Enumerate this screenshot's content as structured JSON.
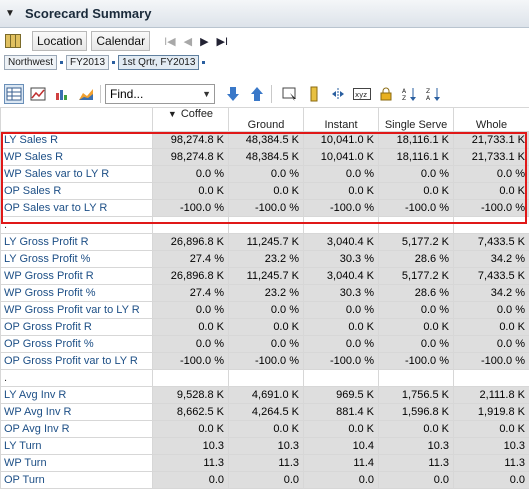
{
  "window": {
    "title": "Scorecard Summary"
  },
  "nav": {
    "location_label": "Location",
    "calendar_label": "Calendar",
    "first_label": "I◀",
    "prev_label": "◀",
    "next_label": "▶",
    "last_label": "▶I"
  },
  "breadcrumbs": [
    "Northwest",
    "FY2013",
    "1st Qrtr, FY2013"
  ],
  "toolbar": {
    "find_placeholder": "Find..."
  },
  "columns": [
    "Coffee",
    "Ground",
    "Instant",
    "Single Serve",
    "Whole"
  ],
  "rows": [
    {
      "label": "LY Sales R",
      "values": [
        "98,274.8 K",
        "48,384.5 K",
        "10,041.0 K",
        "18,116.1 K",
        "21,733.1 K"
      ]
    },
    {
      "label": "WP Sales R",
      "values": [
        "98,274.8 K",
        "48,384.5 K",
        "10,041.0 K",
        "18,116.1 K",
        "21,733.1 K"
      ]
    },
    {
      "label": "WP Sales var to LY R",
      "values": [
        "0.0 %",
        "0.0 %",
        "0.0 %",
        "0.0 %",
        "0.0 %"
      ]
    },
    {
      "label": "OP Sales R",
      "values": [
        "0.0 K",
        "0.0 K",
        "0.0 K",
        "0.0 K",
        "0.0 K"
      ]
    },
    {
      "label": "OP Sales var to LY R",
      "values": [
        "-100.0 %",
        "-100.0 %",
        "-100.0 %",
        "-100.0 %",
        "-100.0 %"
      ]
    },
    {
      "label": ".",
      "values": [
        "",
        "",
        "",
        "",
        ""
      ],
      "spacer": true
    },
    {
      "label": "LY Gross Profit R",
      "values": [
        "26,896.8 K",
        "11,245.7 K",
        "3,040.4 K",
        "5,177.2 K",
        "7,433.5 K"
      ]
    },
    {
      "label": "LY Gross Profit %",
      "values": [
        "27.4 %",
        "23.2 %",
        "30.3 %",
        "28.6 %",
        "34.2 %"
      ]
    },
    {
      "label": "WP Gross Profit R",
      "values": [
        "26,896.8 K",
        "11,245.7 K",
        "3,040.4 K",
        "5,177.2 K",
        "7,433.5 K"
      ]
    },
    {
      "label": "WP Gross Profit %",
      "values": [
        "27.4 %",
        "23.2 %",
        "30.3 %",
        "28.6 %",
        "34.2 %"
      ]
    },
    {
      "label": "WP Gross Profit var to LY R",
      "values": [
        "0.0 %",
        "0.0 %",
        "0.0 %",
        "0.0 %",
        "0.0 %"
      ]
    },
    {
      "label": "OP Gross Profit R",
      "values": [
        "0.0 K",
        "0.0 K",
        "0.0 K",
        "0.0 K",
        "0.0 K"
      ]
    },
    {
      "label": "OP Gross Profit %",
      "values": [
        "0.0 %",
        "0.0 %",
        "0.0 %",
        "0.0 %",
        "0.0 %"
      ]
    },
    {
      "label": "OP Gross Profit var to LY R",
      "values": [
        "-100.0 %",
        "-100.0 %",
        "-100.0 %",
        "-100.0 %",
        "-100.0 %"
      ]
    },
    {
      "label": ".",
      "values": [
        "",
        "",
        "",
        "",
        ""
      ],
      "spacer": true
    },
    {
      "label": "LY Avg Inv R",
      "values": [
        "9,528.8 K",
        "4,691.0 K",
        "969.5 K",
        "1,756.5 K",
        "2,111.8 K"
      ]
    },
    {
      "label": "WP Avg Inv R",
      "values": [
        "8,662.5 K",
        "4,264.5 K",
        "881.4 K",
        "1,596.8 K",
        "1,919.8 K"
      ]
    },
    {
      "label": "OP Avg Inv R",
      "values": [
        "0.0 K",
        "0.0 K",
        "0.0 K",
        "0.0 K",
        "0.0 K"
      ]
    },
    {
      "label": "LY Turn",
      "values": [
        "10.3",
        "10.3",
        "10.4",
        "10.3",
        "10.3"
      ]
    },
    {
      "label": "WP Turn",
      "values": [
        "11.3",
        "11.3",
        "11.4",
        "11.3",
        "11.3"
      ]
    },
    {
      "label": "OP Turn",
      "values": [
        "0.0",
        "0.0",
        "0.0",
        "0.0",
        "0.0"
      ]
    }
  ],
  "highlight_color": "#e01818"
}
